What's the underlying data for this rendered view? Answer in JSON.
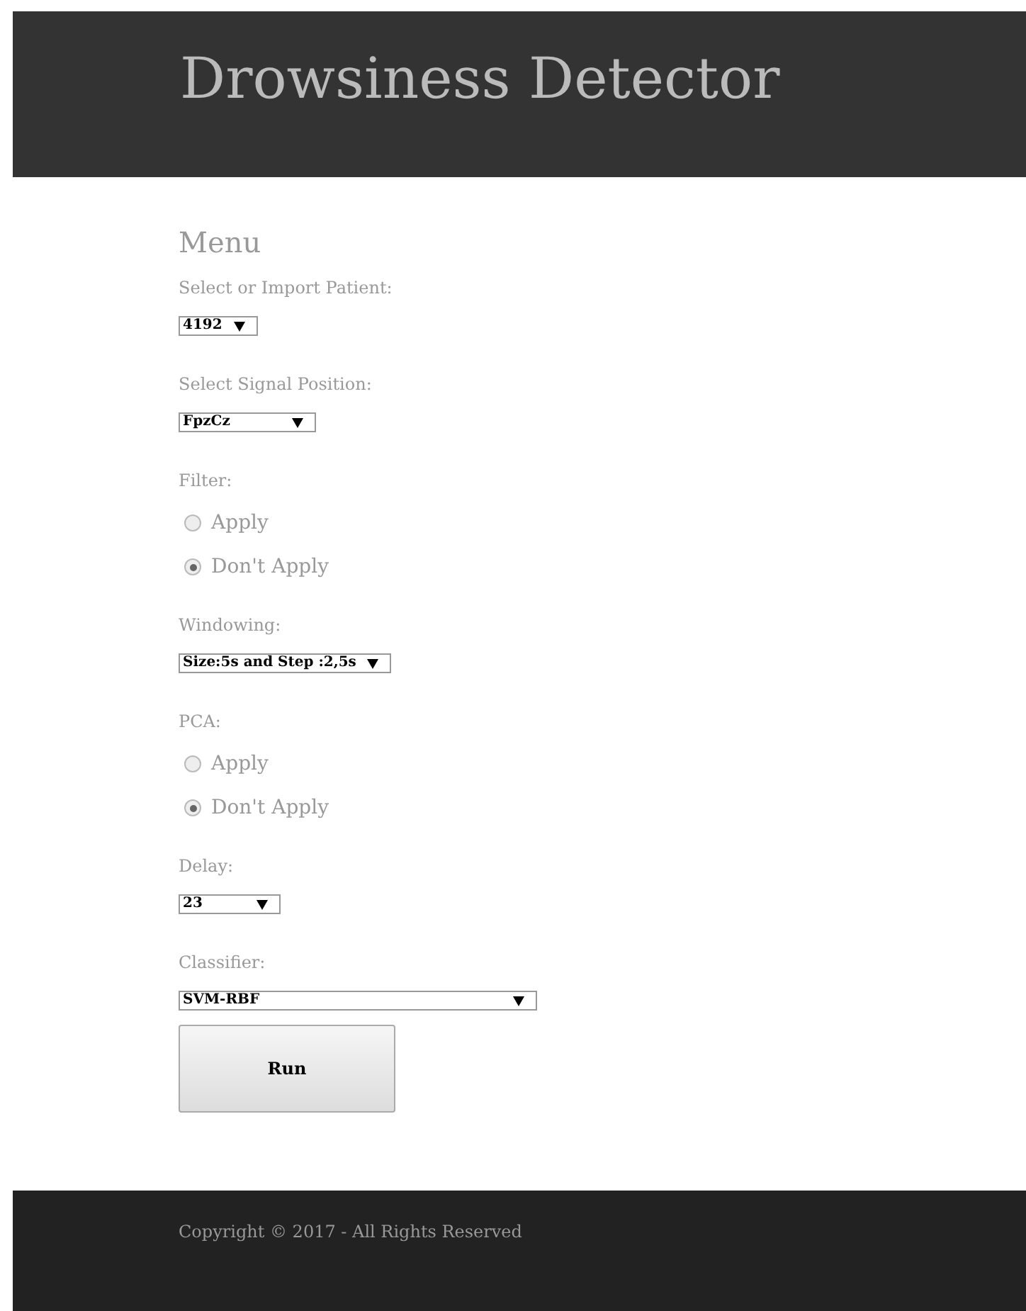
{
  "header": {
    "title": "Drowsiness Detector"
  },
  "menu": {
    "title": "Menu",
    "fields": [
      {
        "kind": "select",
        "label": "Select or Import Patient:",
        "value": "4192"
      },
      {
        "kind": "select",
        "label": "Select Signal Position:",
        "value": "FpzCz"
      },
      {
        "kind": "radio",
        "label": "Filter:",
        "options": [
          {
            "label": "Apply",
            "selected": false
          },
          {
            "label": "Don't Apply",
            "selected": true
          }
        ]
      },
      {
        "kind": "select",
        "label": "Windowing:",
        "value": "Size:5s and Step :2,5s"
      },
      {
        "kind": "radio",
        "label": "PCA:",
        "options": [
          {
            "label": "Apply",
            "selected": false
          },
          {
            "label": "Don't Apply",
            "selected": true
          }
        ]
      },
      {
        "kind": "select",
        "label": "Delay:",
        "value": "23"
      },
      {
        "kind": "select",
        "label": "Classifier:",
        "value": "SVM-RBF"
      }
    ],
    "button": "Run"
  },
  "footer": {
    "text": "Copyright © 2017 - All Rights Reserved"
  }
}
